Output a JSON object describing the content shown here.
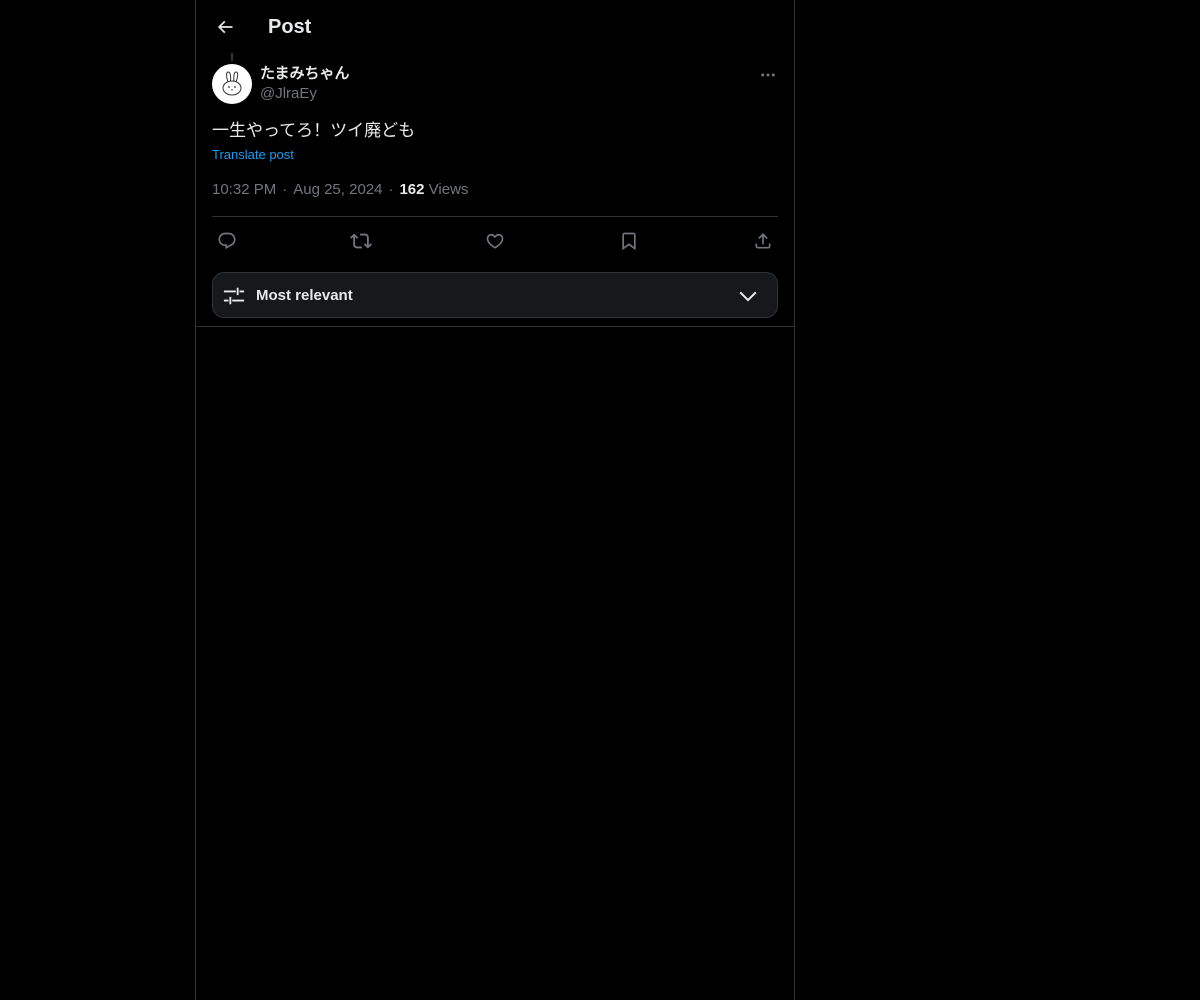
{
  "header": {
    "title": "Post"
  },
  "post": {
    "author": {
      "display_name": "たまみちゃん",
      "handle": "@JlraEy"
    },
    "text": "一生やってろ！ツイ廃ども",
    "translate_label": "Translate post",
    "time": "10:32 PM",
    "date": "Aug 25, 2024",
    "separator": "·",
    "views_count": "162",
    "views_label": "Views"
  },
  "actions": {
    "icons": [
      "reply-icon",
      "repost-icon",
      "like-icon",
      "bookmark-icon",
      "share-icon"
    ]
  },
  "sort": {
    "label": "Most relevant"
  },
  "colors": {
    "background": "#000000",
    "text": "#e7e9ea",
    "muted": "#71767b",
    "link": "#1d9bf0",
    "border": "#2f3336"
  }
}
